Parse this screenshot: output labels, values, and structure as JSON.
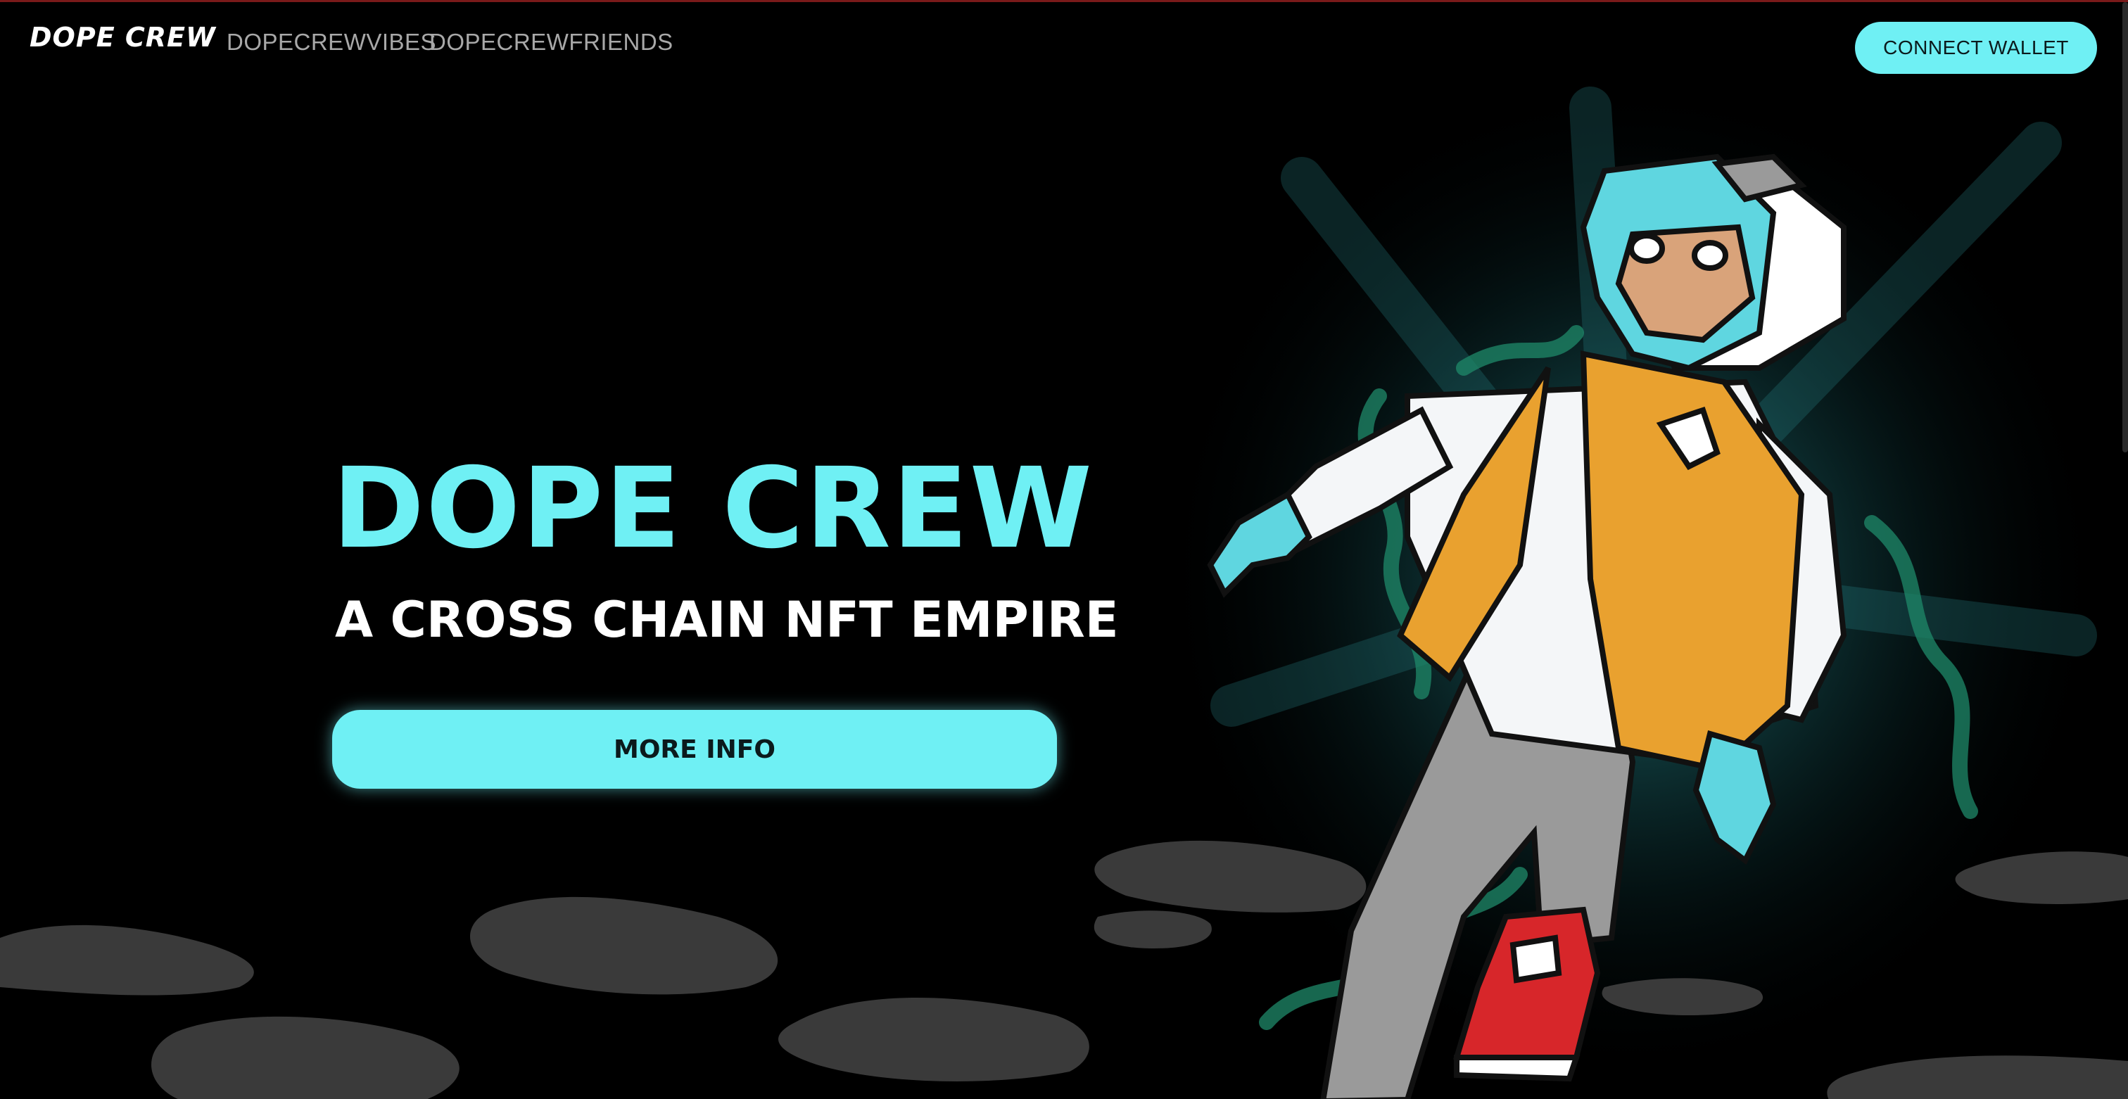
{
  "header": {
    "brand": "DOPE CREW",
    "nav": [
      {
        "label": "DOPECREWVIBES"
      },
      {
        "label": "DOPECREWFRIENDS"
      }
    ],
    "connect_label": "CONNECT WALLET"
  },
  "hero": {
    "title": "DOPE CREW",
    "subtitle": "A CROSS CHAIN NFT EMPIRE",
    "cta_label": "MORE INFO"
  },
  "colors": {
    "accent": "#6ff0f4",
    "background": "#000000",
    "jacket": "#e9a12f",
    "sneaker": "#d7262a"
  },
  "icons": {
    "character_art": "monkey-character-illustration",
    "clouds": "smoke-clouds"
  }
}
